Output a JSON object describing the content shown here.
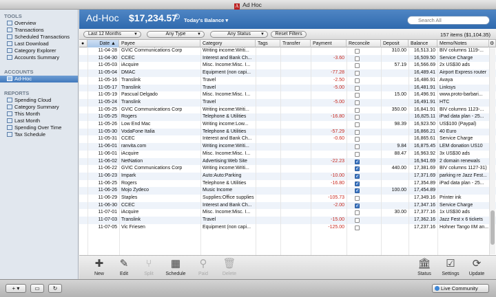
{
  "window": {
    "title": "Ad Hoc"
  },
  "sidebar": {
    "tools_header": "TOOLS",
    "tools": [
      "Overview",
      "Transactions",
      "Scheduled Transactions",
      "Last Download",
      "Category Explorer",
      "Accounts Summary"
    ],
    "accounts_header": "ACCOUNTS",
    "accounts": [
      "Ad-Hoc"
    ],
    "reports_header": "REPORTS",
    "reports": [
      "Spending Cloud",
      "Category Summary",
      "This Month",
      "Last Month",
      "Spending Over Time",
      "Tax Schedule"
    ]
  },
  "header": {
    "title": "Ad-Hoc",
    "balance": "$17,234.57",
    "balance_type": "Today's Balance ▾",
    "info": "i",
    "search_placeholder": "Search All"
  },
  "filters": {
    "period": "Last 12 Months",
    "type": "Any Type",
    "status": "Any Status",
    "reset": "Reset Filters",
    "count": "157 items ($1,104.35)"
  },
  "columns": {
    "flag": "●",
    "date": "Date ▲",
    "payee": "Payee",
    "category": "Category",
    "tags": "Tags",
    "transfer": "Transfer",
    "payment": "Payment",
    "reconcile": "Reconcile",
    "deposit": "Deposit",
    "balance": "Balance",
    "memo": "Memo/Notes",
    "gear": "⚙"
  },
  "rows": [
    {
      "date": "11-04-28",
      "payee": "GVIC Communications Corp",
      "category": "Writing income:Writi...",
      "payment": "",
      "rec": false,
      "deposit": "310.00",
      "balance": "16,513.10",
      "memo": "BIV columns 1119-..."
    },
    {
      "date": "11-04-30",
      "payee": "CCEC",
      "category": "Interest and Bank Ch...",
      "payment": "-3.60",
      "rec": false,
      "deposit": "",
      "balance": "16,509.50",
      "memo": "Service Charge"
    },
    {
      "date": "11-05-03",
      "payee": "iAcquire",
      "category": "Misc. Income:Misc. I...",
      "payment": "",
      "rec": false,
      "deposit": "57.19",
      "balance": "16,566.69",
      "memo": "2x US$30 ads"
    },
    {
      "date": "11-05-04",
      "payee": "DMAC",
      "category": "Equipment (non capi...",
      "payment": "-77.28",
      "rec": false,
      "deposit": "",
      "balance": "16,489.41",
      "memo": "Airport Express router"
    },
    {
      "date": "11-05-16",
      "payee": "Translink",
      "category": "Travel",
      "payment": "-2.50",
      "rec": false,
      "deposit": "",
      "balance": "16,486.91",
      "memo": "Avaya"
    },
    {
      "date": "11-05-17",
      "payee": "Translink",
      "category": "Travel",
      "payment": "-5.00",
      "rec": false,
      "deposit": "",
      "balance": "16,481.91",
      "memo": "Linksys"
    },
    {
      "date": "11-05-19",
      "payee": "Pascual Delgado",
      "category": "Misc. Income:Misc. I...",
      "payment": "",
      "rec": false,
      "deposit": "15.00",
      "balance": "16,496.91",
      "memo": "www.proto-barbari..."
    },
    {
      "date": "11-05-24",
      "payee": "Translink",
      "category": "Travel",
      "payment": "-5.00",
      "rec": false,
      "deposit": "",
      "balance": "16,491.91",
      "memo": "HTC"
    },
    {
      "date": "11-05-25",
      "payee": "GVIC Communications Corp",
      "category": "Writing income:Writi...",
      "payment": "",
      "rec": false,
      "deposit": "350.00",
      "balance": "16,841.91",
      "memo": "BIV columns 1123-..."
    },
    {
      "date": "11-05-25",
      "payee": "Rogers",
      "category": "Telephone & Utilities",
      "payment": "-16.80",
      "rec": false,
      "deposit": "",
      "balance": "16,825.11",
      "memo": "iPad data plan - 25..."
    },
    {
      "date": "11-05-26",
      "payee": "Low End Mac",
      "category": "Writing income:Low...",
      "payment": "",
      "rec": false,
      "deposit": "98.39",
      "balance": "16,923.50",
      "memo": "US$100 (Paypal)"
    },
    {
      "date": "11-05-30",
      "payee": "VodaFone Italia",
      "category": "Telephone & Utilities",
      "payment": "-57.29",
      "rec": false,
      "deposit": "",
      "balance": "16,866.21",
      "memo": "40 Euro"
    },
    {
      "date": "11-05-31",
      "payee": "CCEC",
      "category": "Interest and Bank Ch...",
      "payment": "-0.60",
      "rec": false,
      "deposit": "",
      "balance": "16,865.61",
      "memo": "Service Charge"
    },
    {
      "date": "11-06-01",
      "payee": "ranvita.com",
      "category": "Writing income:Writi...",
      "payment": "",
      "rec": false,
      "deposit": "9.84",
      "balance": "16,875.45",
      "memo": "LEM donation US10"
    },
    {
      "date": "11-06-01",
      "payee": "iAcquire",
      "category": "Misc. Income:Misc. I...",
      "payment": "",
      "rec": false,
      "deposit": "88.47",
      "balance": "16,963.92",
      "memo": "3x US$30 ads"
    },
    {
      "date": "11-06-02",
      "payee": "NetNation",
      "category": "Advertising:Web Site",
      "payment": "-22.23",
      "rec": true,
      "deposit": "",
      "balance": "16,941.69",
      "memo": "2 domain renewals"
    },
    {
      "date": "11-06-22",
      "payee": "GVIC Communications Corp",
      "category": "Writing income:Writi...",
      "payment": "",
      "rec": true,
      "deposit": "440.00",
      "balance": "17,381.69",
      "memo": "BIV columns 1127-31)"
    },
    {
      "date": "11-06-23",
      "payee": "Impark",
      "category": "Auto:Auto:Parking",
      "payment": "-10.00",
      "rec": true,
      "deposit": "",
      "balance": "17,371.69",
      "memo": "parking re Jazz Fest..."
    },
    {
      "date": "11-06-25",
      "payee": "Rogers",
      "category": "Telephone & Utilities",
      "payment": "-16.80",
      "rec": true,
      "deposit": "",
      "balance": "17,354.89",
      "memo": "iPad data plan - 25..."
    },
    {
      "date": "11-06-26",
      "payee": "Mojo Zydeco",
      "category": "Music Income",
      "payment": "",
      "rec": true,
      "deposit": "100.00",
      "balance": "17,454.89",
      "memo": ""
    },
    {
      "date": "11-06-29",
      "payee": "Staples",
      "category": "Supplies:Office supplies",
      "payment": "-105.73",
      "rec": false,
      "deposit": "",
      "balance": "17,349.16",
      "memo": "Printer ink"
    },
    {
      "date": "11-06-30",
      "payee": "CCEC",
      "category": "Interest and Bank Ch...",
      "payment": "-2.00",
      "rec": true,
      "deposit": "",
      "balance": "17,347.16",
      "memo": "Service Charge"
    },
    {
      "date": "11-07-01",
      "payee": "iAcquire",
      "category": "Misc. Income:Misc. I...",
      "payment": "",
      "rec": false,
      "deposit": "30.00",
      "balance": "17,377.16",
      "memo": "1x US$30 ads"
    },
    {
      "date": "11-07-03",
      "payee": "Translink",
      "category": "Travel",
      "payment": "-15.00",
      "rec": false,
      "deposit": "",
      "balance": "17,362.16",
      "memo": "Jazz Fest x 6 tickets"
    },
    {
      "date": "11-07-05",
      "payee": "Vic Friesen",
      "category": "Equipment (non capi...",
      "payment": "-125.00",
      "rec": false,
      "deposit": "",
      "balance": "17,237.16",
      "memo": "Hohner Tango IIM an..."
    }
  ],
  "toolbar": {
    "new": "New",
    "edit": "Edit",
    "split": "Split",
    "schedule": "Schedule",
    "paid": "Paid",
    "delete": "Delete",
    "status": "Status",
    "settings": "Settings",
    "update": "Update"
  },
  "bottom": {
    "add": "+ ▾",
    "live": "Live Community"
  }
}
